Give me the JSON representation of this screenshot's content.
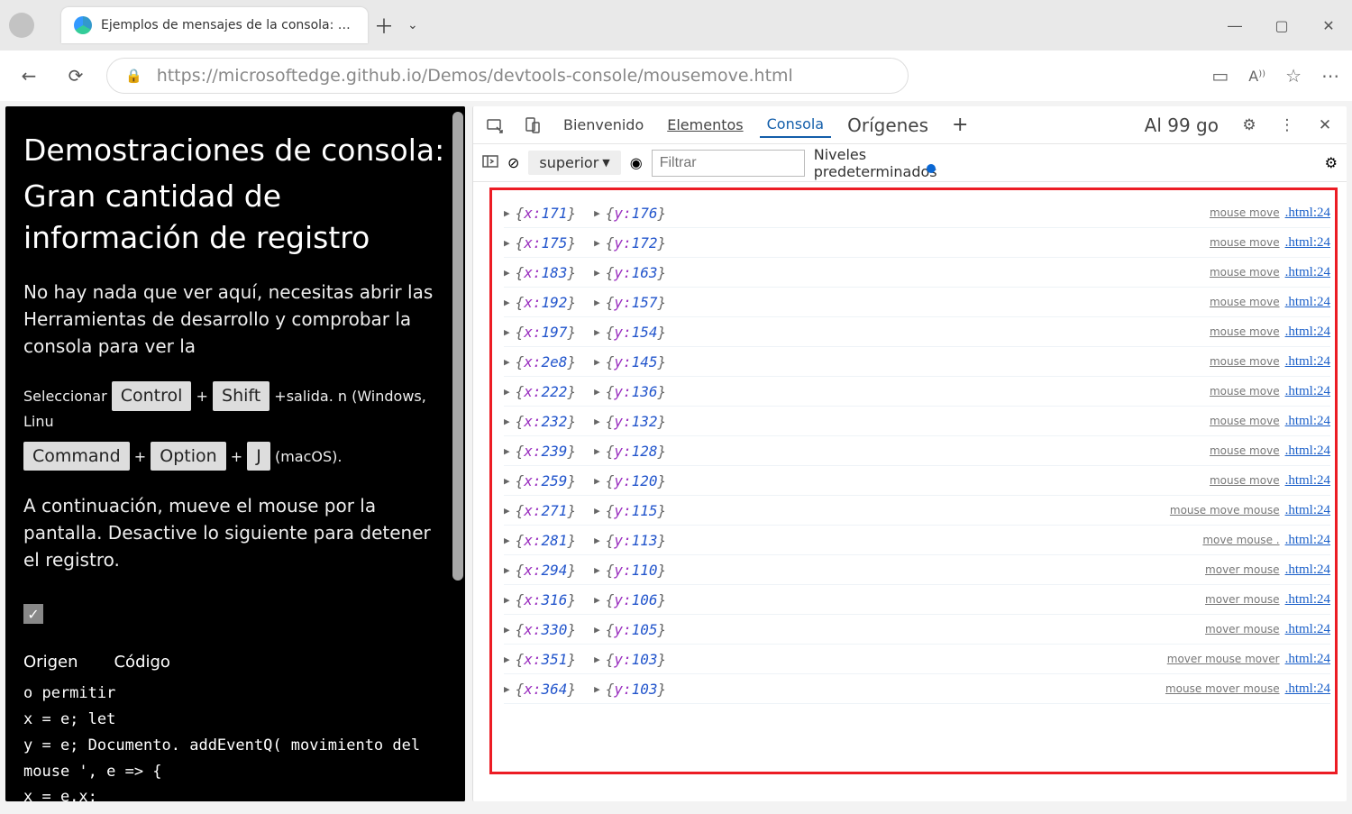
{
  "titlebar": {
    "tab_title": "Ejemplos de mensajes de la consola: Usar"
  },
  "addr": {
    "url": "https://microsoftedge.github.io/Demos/devtools-console/mousemove.html"
  },
  "page": {
    "h1": "Demostraciones de consola:",
    "h2": "Gran cantidad de información de registro",
    "p1": "No hay nada que ver aquí, necesitas abrir las Herramientas de desarrollo y comprobar la consola para ver la",
    "select_prefix": "Seleccionar",
    "kbd_ctrl": "Control",
    "kbd_shift": "Shift",
    "plus": "+",
    "after_shift": "salida. n (Windows, Linu",
    "kbd_command": "Command",
    "kbd_option": "Option",
    "kbd_j": "J",
    "macos": "(macOS).",
    "p2": "A continuación, mueve el mouse por la pantalla. Desactive lo siguiente para detener el registro.",
    "code_hdr_left": "Origen",
    "code_hdr_right": "Código",
    "code_l1": "o permitir",
    "code_l2": "x = e; let",
    "code_l3": "y = e; Documento. addEventQ( movimiento del mouse ',  e  =>  {",
    "code_l4": "    x  =  e.x;"
  },
  "devtools": {
    "tab_welcome": "Bienvenido",
    "tab_elements": "Elementos",
    "tab_console": "Consola",
    "tab_sources": "Orígenes",
    "plus": "+",
    "right_text": "Al 99 go",
    "context": "superior",
    "filter_placeholder": "Filtrar",
    "levels": "Niveles predeterminados",
    "rows": [
      {
        "x": "171",
        "y": "176",
        "src": "mouse move",
        "loc": ".html:24"
      },
      {
        "x": "175",
        "y": "172",
        "src": "mouse move",
        "loc": ".html:24"
      },
      {
        "x": "183",
        "y": "163",
        "src": "mouse move",
        "loc": ".html:24"
      },
      {
        "x": "192",
        "y": "157",
        "src": "mouse move",
        "loc": ".html:24"
      },
      {
        "x": "197",
        "y": "154",
        "src": "mouse move",
        "loc": ".html:24"
      },
      {
        "x": "2e8",
        "y": "145",
        "src": "mouse move",
        "loc": ".html:24"
      },
      {
        "x": "222",
        "y": "136",
        "src": "mouse move",
        "loc": ".html:24"
      },
      {
        "x": "232",
        "y": "132",
        "src": "mouse move",
        "loc": ".html:24"
      },
      {
        "x": "239",
        "y": "128",
        "src": "mouse move",
        "loc": ".html:24"
      },
      {
        "x": "259",
        "y": "120",
        "src": "mouse move",
        "loc": ".html:24"
      },
      {
        "x": "271",
        "y": "115",
        "src": "mouse move mouse",
        "loc": ".html:24"
      },
      {
        "x": "281",
        "y": "113",
        "src": "move mouse .",
        "loc": ".html:24"
      },
      {
        "x": "294",
        "y": "110",
        "src": "mover mouse",
        "loc": ".html:24"
      },
      {
        "x": "316",
        "y": "106",
        "src": "mover mouse",
        "loc": ".html:24"
      },
      {
        "x": "330",
        "y": "105",
        "src": "mover mouse",
        "loc": ".html:24"
      },
      {
        "x": "351",
        "y": "103",
        "src": "mover mouse mover",
        "loc": ".html:24"
      },
      {
        "x": "364",
        "y": "103",
        "src": "mouse mover mouse",
        "loc": ".html:24"
      }
    ]
  }
}
